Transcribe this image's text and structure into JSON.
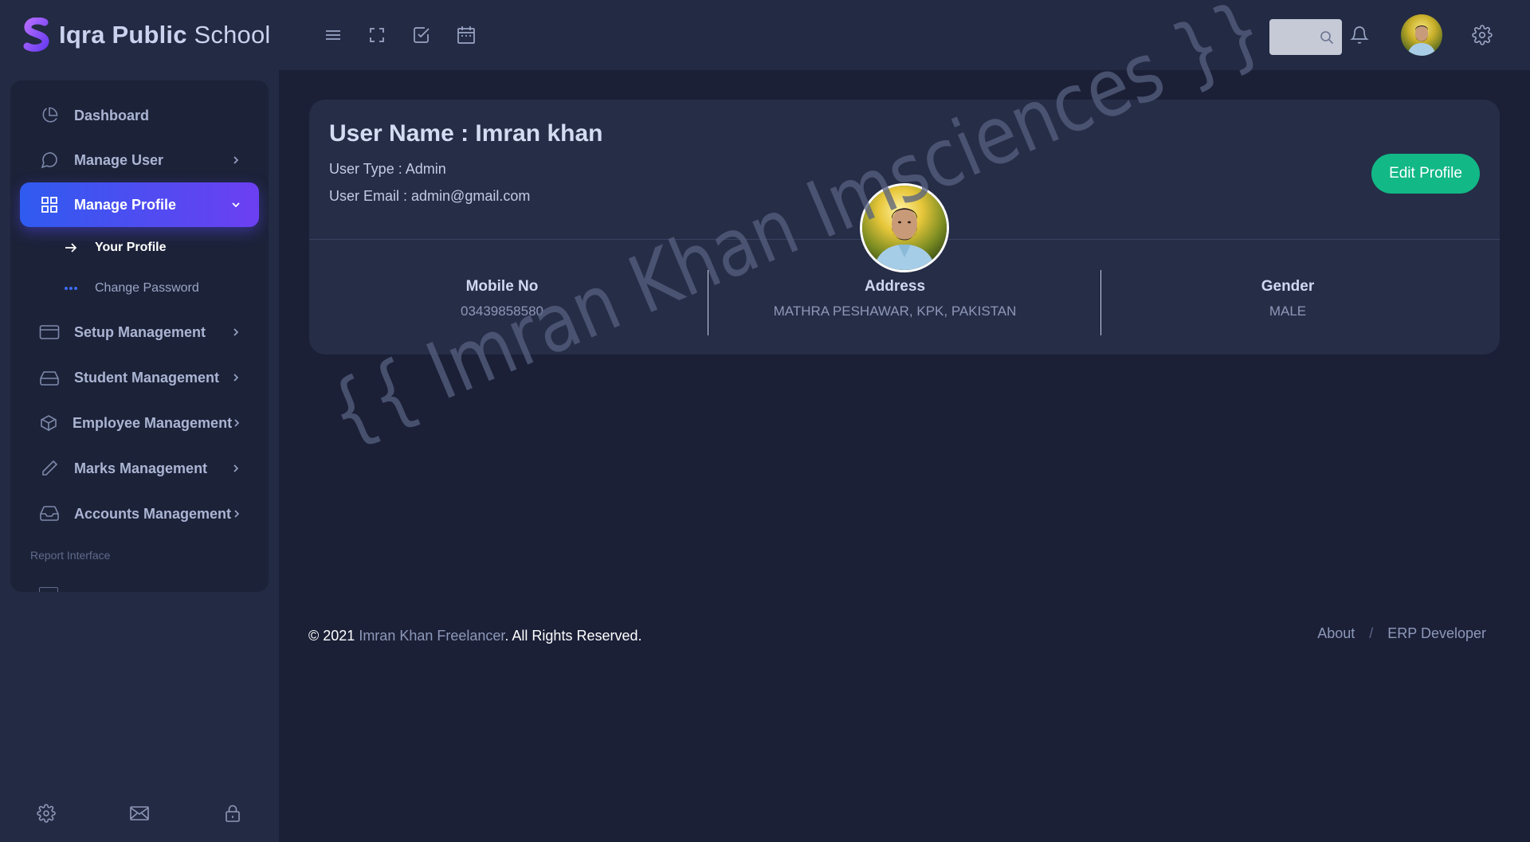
{
  "brand": {
    "name_bold": "Iqra Public",
    "name_light": "School",
    "logo_icon": "s-logo-icon"
  },
  "sidebar": {
    "items": [
      {
        "label": "Dashboard",
        "icon": "pie-chart-icon"
      },
      {
        "label": "Manage User",
        "icon": "chat-bubble-icon"
      },
      {
        "label": "Manage Profile",
        "icon": "grid-icon",
        "active": true
      },
      {
        "label": "Setup Management",
        "icon": "credit-card-icon"
      },
      {
        "label": "Student Management",
        "icon": "hard-drive-icon"
      },
      {
        "label": "Employee Management",
        "icon": "box-icon"
      },
      {
        "label": "Marks Management",
        "icon": "pencil-icon"
      },
      {
        "label": "Accounts Management",
        "icon": "inbox-icon"
      }
    ],
    "subitems": [
      {
        "label": "Your Profile",
        "icon": "arrow-right-icon",
        "current": true
      },
      {
        "label": "Change Password",
        "icon": "dots-icon"
      }
    ],
    "section_label": "Report Interface",
    "bottom_icons": [
      "gear-icon",
      "mail-icon",
      "lock-icon"
    ]
  },
  "topbar": {
    "icons": [
      "menu-icon",
      "fullscreen-icon",
      "check-square-icon",
      "calendar-icon"
    ],
    "search": {
      "placeholder": ""
    },
    "right_icons": [
      "bell-icon",
      "avatar",
      "gear-icon"
    ]
  },
  "profile": {
    "title": "User Name : Imran khan",
    "user_type": "User Type : Admin",
    "user_email": "User Email : admin@gmail.com",
    "edit_button": "Edit Profile",
    "stats": [
      {
        "label": "Mobile No",
        "value": "03439858580"
      },
      {
        "label": "Address",
        "value": "MATHRA PESHAWAR, KPK, PAKISTAN"
      },
      {
        "label": "Gender",
        "value": "MALE"
      }
    ]
  },
  "watermark": "{{ Imran Khan Imsciences }}",
  "footer": {
    "copyright_prefix": "© 2021 ",
    "copyright_link": "Imran Khan Freelancer",
    "copyright_suffix": ". All Rights Reserved.",
    "links": [
      "About",
      "ERP Developer"
    ],
    "separator": "/"
  },
  "colors": {
    "background": "#1b2037",
    "panel": "#232a43",
    "card": "#262d47",
    "accent_gradient_start": "#2f5bf0",
    "accent_gradient_end": "#6c3ff2",
    "edit_button": "#12b886"
  }
}
